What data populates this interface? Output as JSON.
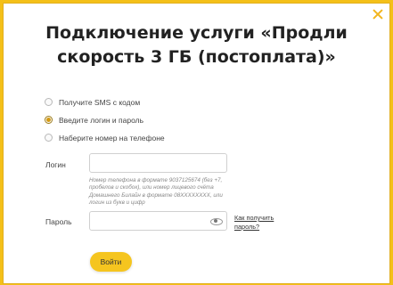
{
  "dialog": {
    "title": "Подключение услуги «Продли скорость 3 ГБ (постоплата)»"
  },
  "auth_options": [
    {
      "label": "Получите SMS с кодом",
      "selected": false
    },
    {
      "label": "Введите логин и пароль",
      "selected": true
    },
    {
      "label": "Наберите номер на телефоне",
      "selected": false
    }
  ],
  "form": {
    "login_label": "Логин",
    "login_value": "",
    "login_hint": "Номер телефона в формате 9037125674 (без +7, пробелов и скобок), или номер лицевого счёта Домашнего Билайн в формате 08XXXXXXXX, или логин из букв и цифр",
    "password_label": "Пароль",
    "password_value": "",
    "forgot_link": "Как получить пароль?",
    "submit_label": "Войти"
  },
  "colors": {
    "brand_yellow": "#f4c018",
    "radio_selected": "#d59a12"
  }
}
